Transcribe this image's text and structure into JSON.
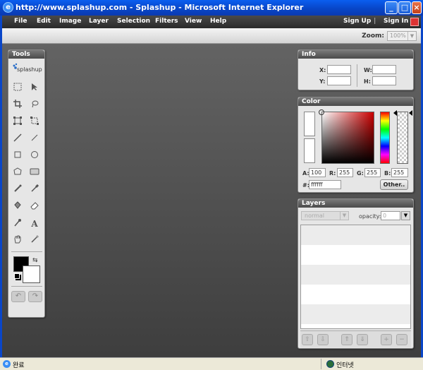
{
  "window": {
    "title": "http://www.splashup.com - Splashup - Microsoft Internet Explorer",
    "icon": "ie-icon"
  },
  "menu": {
    "items": [
      "File",
      "Edit",
      "Image",
      "Layer",
      "Selection",
      "Filters",
      "View",
      "Help"
    ],
    "sign_up": "Sign Up",
    "separator": "|",
    "sign_in": "Sign In"
  },
  "zoom": {
    "label": "Zoom:",
    "value": "100%"
  },
  "tools": {
    "title": "Tools",
    "logo": "splashup"
  },
  "info": {
    "title": "Info",
    "x_label": "X:",
    "y_label": "Y:",
    "w_label": "W:",
    "h_label": "H:"
  },
  "color": {
    "title": "Color",
    "a_label": "A:",
    "a_value": "100",
    "r_label": "R:",
    "r_value": "255",
    "g_label": "G:",
    "g_value": "255",
    "b_label": "B:",
    "b_value": "255",
    "hex_label": "#:",
    "hex_value": "ffffff",
    "other_button": "Other.."
  },
  "layers": {
    "title": "Layers",
    "blend_mode": "normal",
    "opacity_label": "opacity:",
    "opacity_value": "0"
  },
  "status": {
    "left": "완료",
    "right": "인터넷"
  },
  "colors": {
    "title_bar": "#0a46c8",
    "menu_bar": "#333333",
    "workspace": "#555555",
    "panel": "#e6e6e6"
  }
}
